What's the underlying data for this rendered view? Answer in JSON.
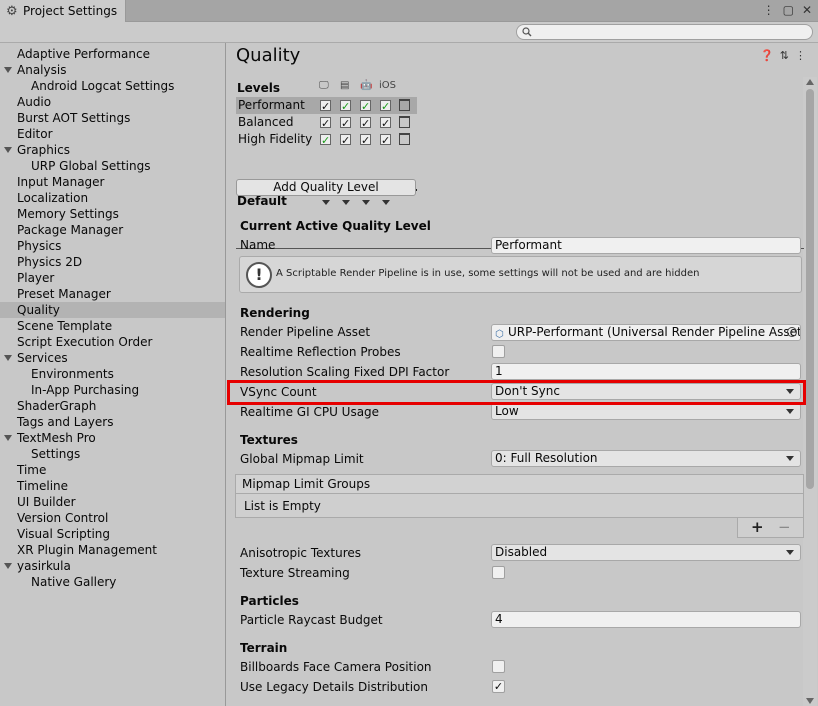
{
  "window": {
    "tab_title": "Project Settings",
    "title_menu_icon": "kebab-menu-icon",
    "maximize_icon": "maximize-icon",
    "close_icon": "close-icon"
  },
  "search": {
    "value": "",
    "placeholder": ""
  },
  "sidebar": {
    "items": [
      {
        "label": "Adaptive Performance",
        "depth": 0,
        "expandable": false
      },
      {
        "label": "Analysis",
        "depth": 0,
        "expandable": true
      },
      {
        "label": "Android Logcat Settings",
        "depth": 1,
        "expandable": false
      },
      {
        "label": "Audio",
        "depth": 0,
        "expandable": false
      },
      {
        "label": "Burst AOT Settings",
        "depth": 0,
        "expandable": false
      },
      {
        "label": "Editor",
        "depth": 0,
        "expandable": false
      },
      {
        "label": "Graphics",
        "depth": 0,
        "expandable": true
      },
      {
        "label": "URP Global Settings",
        "depth": 1,
        "expandable": false
      },
      {
        "label": "Input Manager",
        "depth": 0,
        "expandable": false
      },
      {
        "label": "Localization",
        "depth": 0,
        "expandable": false
      },
      {
        "label": "Memory Settings",
        "depth": 0,
        "expandable": false
      },
      {
        "label": "Package Manager",
        "depth": 0,
        "expandable": false
      },
      {
        "label": "Physics",
        "depth": 0,
        "expandable": false
      },
      {
        "label": "Physics 2D",
        "depth": 0,
        "expandable": false
      },
      {
        "label": "Player",
        "depth": 0,
        "expandable": false
      },
      {
        "label": "Preset Manager",
        "depth": 0,
        "expandable": false
      },
      {
        "label": "Quality",
        "depth": 0,
        "expandable": false,
        "selected": true
      },
      {
        "label": "Scene Template",
        "depth": 0,
        "expandable": false
      },
      {
        "label": "Script Execution Order",
        "depth": 0,
        "expandable": false
      },
      {
        "label": "Services",
        "depth": 0,
        "expandable": true
      },
      {
        "label": "Environments",
        "depth": 1,
        "expandable": false
      },
      {
        "label": "In-App Purchasing",
        "depth": 1,
        "expandable": false
      },
      {
        "label": "ShaderGraph",
        "depth": 0,
        "expandable": false
      },
      {
        "label": "Tags and Layers",
        "depth": 0,
        "expandable": false
      },
      {
        "label": "TextMesh Pro",
        "depth": 0,
        "expandable": true
      },
      {
        "label": "Settings",
        "depth": 1,
        "expandable": false
      },
      {
        "label": "Time",
        "depth": 0,
        "expandable": false
      },
      {
        "label": "Timeline",
        "depth": 0,
        "expandable": false
      },
      {
        "label": "UI Builder",
        "depth": 0,
        "expandable": false
      },
      {
        "label": "Version Control",
        "depth": 0,
        "expandable": false
      },
      {
        "label": "Visual Scripting",
        "depth": 0,
        "expandable": false
      },
      {
        "label": "XR Plugin Management",
        "depth": 0,
        "expandable": false
      },
      {
        "label": "yasirkula",
        "depth": 0,
        "expandable": true
      },
      {
        "label": "Native Gallery",
        "depth": 1,
        "expandable": false
      }
    ]
  },
  "main": {
    "title": "Quality",
    "levels": {
      "heading": "Levels",
      "ios_label": "iOS",
      "rows": [
        {
          "name": "Performant",
          "checks": [
            "black",
            "green",
            "green",
            "green"
          ],
          "selected": true
        },
        {
          "name": "Balanced",
          "checks": [
            "black",
            "black",
            "black",
            "black"
          ],
          "selected": false
        },
        {
          "name": "High Fidelity",
          "checks": [
            "green",
            "black",
            "black",
            "black"
          ],
          "selected": false
        }
      ],
      "default_label": "Default",
      "add_button": "Add Quality Level"
    },
    "current": {
      "heading": "Current Active Quality Level",
      "name_label": "Name",
      "name_value": "Performant",
      "help_text": "A Scriptable Render Pipeline is in use, some settings will not be used and are hidden"
    },
    "rendering": {
      "heading": "Rendering",
      "pipeline_label": "Render Pipeline Asset",
      "pipeline_value": "URP-Performant (Universal Render Pipeline Asset",
      "reflection_label": "Realtime Reflection Probes",
      "reflection_checked": false,
      "dpi_label": "Resolution Scaling Fixed DPI Factor",
      "dpi_value": "1",
      "vsync_label": "VSync Count",
      "vsync_value": "Don't Sync",
      "gi_label": "Realtime GI CPU Usage",
      "gi_value": "Low"
    },
    "textures": {
      "heading": "Textures",
      "mipmap_label": "Global Mipmap Limit",
      "mipmap_value": "0: Full Resolution",
      "groups_header": "Mipmap Limit Groups",
      "groups_empty": "List is Empty",
      "plus": "+",
      "minus": "−",
      "aniso_label": "Anisotropic Textures",
      "aniso_value": "Disabled",
      "streaming_label": "Texture Streaming",
      "streaming_checked": false
    },
    "particles": {
      "heading": "Particles",
      "raycast_label": "Particle Raycast Budget",
      "raycast_value": "4"
    },
    "terrain": {
      "heading": "Terrain",
      "billboard_label": "Billboards Face Camera Position",
      "billboard_checked": false,
      "legacy_label": "Use Legacy Details Distribution",
      "legacy_checked": true,
      "check_glyph": "✓"
    }
  },
  "colors": {
    "highlight": "#e60000",
    "green_check": "#1a9a1a"
  }
}
